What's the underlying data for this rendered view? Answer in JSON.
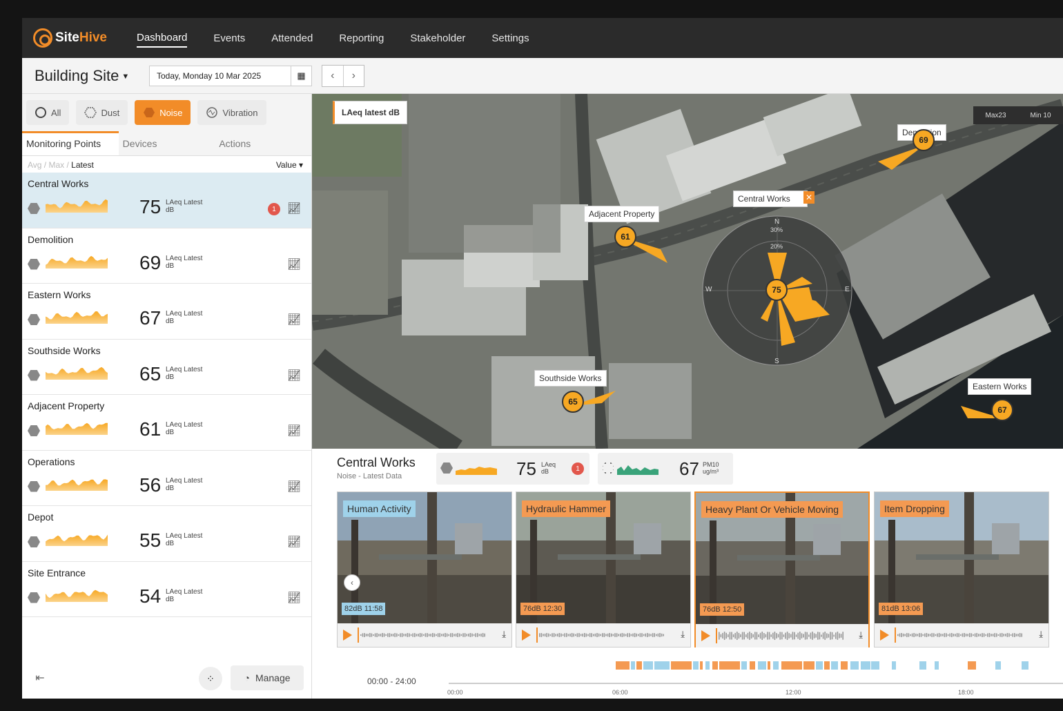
{
  "app": {
    "logo_text_a": "Site",
    "logo_text_b": "Hive"
  },
  "nav": [
    {
      "label": "Dashboard",
      "active": true
    },
    {
      "label": "Events"
    },
    {
      "label": "Attended"
    },
    {
      "label": "Reporting"
    },
    {
      "label": "Stakeholder"
    },
    {
      "label": "Settings"
    }
  ],
  "header": {
    "site": "Building Site",
    "date": "Today,  Monday 10 Mar 2025"
  },
  "filters": [
    "All",
    "Dust",
    "Noise",
    "Vibration"
  ],
  "tabs": [
    "Monitoring Points",
    "Devices",
    "Actions"
  ],
  "sort": {
    "muted": "Avg / Max /",
    "active": "Latest",
    "value": "Value"
  },
  "unit_main": "LAeq Latest",
  "unit_sub": "dB",
  "points": [
    {
      "name": "Central Works",
      "value": "75",
      "alert": "1",
      "selected": true
    },
    {
      "name": "Demolition",
      "value": "69"
    },
    {
      "name": "Eastern Works",
      "value": "67"
    },
    {
      "name": "Southside Works",
      "value": "65"
    },
    {
      "name": "Adjacent Property",
      "value": "61"
    },
    {
      "name": "Operations",
      "value": "56"
    },
    {
      "name": "Depot",
      "value": "55"
    },
    {
      "name": "Site Entrance",
      "value": "54"
    }
  ],
  "footer": {
    "manage": "Manage"
  },
  "map": {
    "layer_label": "LAeq latest dB",
    "legend_max": "Max23",
    "legend_min": "Min 10",
    "labels": {
      "demolition": "Demolition",
      "central": "Central Works",
      "adjacent": "Adjacent Property",
      "southside": "Southside Works",
      "eastern": "Eastern Works"
    },
    "bubbles": {
      "demolition": "69",
      "adjacent": "61",
      "central": "75",
      "southside": "65",
      "eastern": "67"
    },
    "compass": {
      "n": "N",
      "s": "S",
      "w": "W",
      "e": "E",
      "pct30": "30%",
      "pct20": "20%"
    }
  },
  "detail": {
    "title": "Central Works",
    "subtitle": "Noise - Latest Data",
    "noise_value": "75",
    "noise_unit": "LAeq",
    "noise_sub": "dB",
    "alert": "1",
    "dust_value": "67",
    "dust_unit": "PM10",
    "dust_sub": "ug/m³"
  },
  "clips": [
    {
      "tag": "Human Activity",
      "time": "82dB 11:58",
      "kind": "blue"
    },
    {
      "tag": "Hydraulic Hammer",
      "time": "76dB 12:30",
      "kind": "orange"
    },
    {
      "tag": "Heavy Plant Or Vehicle Moving",
      "time": "76dB 12:50",
      "kind": "orange",
      "selected": true
    },
    {
      "tag": "Item Dropping",
      "time": "81dB 13:06",
      "kind": "orange"
    }
  ],
  "timeline": {
    "range": "00:00 - 24:00",
    "ticks": [
      "00:00",
      "06:00",
      "12:00",
      "18:00"
    ]
  },
  "colors": {
    "accent": "#f28c28",
    "nav_bg": "#2b2b2b",
    "marker": "#f7a823",
    "blue_tag": "#9fd2ea",
    "selected_row": "#dcebf2"
  }
}
